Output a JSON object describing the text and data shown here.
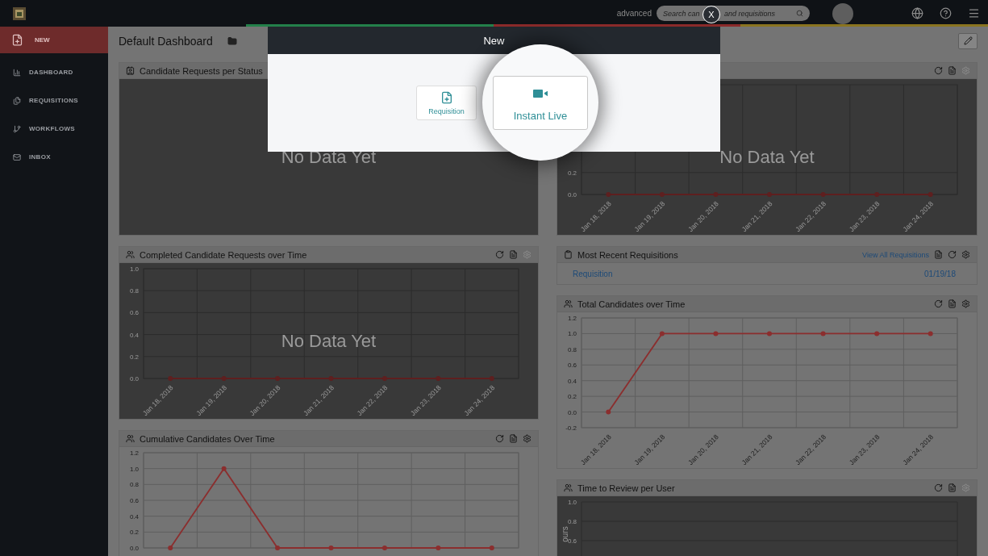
{
  "topbar": {
    "advanced_link": "advanced",
    "search": {
      "placeholder": "Search can",
      "placeholder_rest": "and requisitions"
    },
    "close_button": "X"
  },
  "sidebar": {
    "items": [
      {
        "label": "NEW",
        "kind": "action"
      },
      {
        "label": "DASHBOARD",
        "kind": "nav"
      },
      {
        "label": "REQUISITIONS",
        "kind": "nav"
      },
      {
        "label": "WORKFLOWS",
        "kind": "nav"
      },
      {
        "label": "INBOX",
        "kind": "nav"
      }
    ]
  },
  "dashboard": {
    "title": "Default Dashboard"
  },
  "columns": [
    {
      "panels": [
        {
          "kind": "empty",
          "title": "Candidate Requests per Status",
          "empty_text": "No Data Yet"
        },
        {
          "kind": "chart",
          "title": "Completed Candidate Requests over Time",
          "settings_enabled": false,
          "empty_text": "No Data Yet",
          "chart_data": {
            "type": "line",
            "grid": true,
            "categories": [
              "Jan 18, 2018",
              "Jan 19, 2018",
              "Jan 20, 2018",
              "Jan 21, 2018",
              "Jan 22, 2018",
              "Jan 23, 2018",
              "Jan 24, 2018"
            ],
            "series": [
              {
                "color": "#5e1f1f",
                "marker": "circle",
                "values": [
                  0,
                  0,
                  0,
                  0,
                  0,
                  0,
                  0
                ]
              }
            ],
            "ylim": [
              0,
              1
            ],
            "yticks": [
              {
                "value": 0,
                "label": "0.0"
              },
              {
                "value": 0.2,
                "label": "0.2"
              },
              {
                "value": 0.4,
                "label": "0.4"
              },
              {
                "value": 0.6,
                "label": "0.6"
              },
              {
                "value": 0.8,
                "label": "0.8"
              },
              {
                "value": 1,
                "label": "1.0"
              }
            ]
          }
        },
        {
          "kind": "chart",
          "title": "Cumulative Candidates Over Time",
          "settings_enabled": true,
          "chart_data": {
            "type": "line",
            "grid": true,
            "series": [
              {
                "color": "#8b2e2e",
                "marker": "circle",
                "values": [
                  0,
                  1,
                  0,
                  0,
                  0,
                  0,
                  0
                ]
              }
            ],
            "ylim": [
              0,
              1.2
            ],
            "yticks": [
              {
                "value": 0,
                "label": "0.0"
              },
              {
                "value": 0.2,
                "label": "0.2"
              },
              {
                "value": 0.4,
                "label": "0.4"
              },
              {
                "value": 0.6,
                "label": "0.6"
              },
              {
                "value": 0.8,
                "label": "0.8"
              },
              {
                "value": 1,
                "label": "1.0"
              },
              {
                "value": 1.2,
                "label": "1.2"
              }
            ]
          }
        }
      ]
    },
    {
      "panels": [
        {
          "kind": "chart",
          "settings_enabled": false,
          "empty_text": "No Data Yet",
          "chart_data": {
            "type": "line",
            "grid": true,
            "categories": [
              "Jan 18, 2018",
              "Jan 19, 2018",
              "Jan 20, 2018",
              "Jan 21, 2018",
              "Jan 22, 2018",
              "Jan 23, 2018",
              "Jan 24, 2018"
            ],
            "series": [
              {
                "color": "#5e1f1f",
                "marker": "circle",
                "values": [
                  0,
                  0,
                  0,
                  0,
                  0,
                  0,
                  0
                ]
              }
            ],
            "ylim": [
              0,
              1
            ],
            "yticks": [
              {
                "value": 0,
                "label": "0.0"
              },
              {
                "value": 0.2,
                "label": "0.2"
              }
            ]
          }
        },
        {
          "kind": "list",
          "title": "Most Recent Requisitions",
          "link": "View All Requisitions",
          "settings_enabled": true,
          "rows": [
            {
              "name": "Requisition",
              "date": "01/19/18"
            }
          ]
        },
        {
          "kind": "chart",
          "title": "Total Candidates over Time",
          "settings_enabled": true,
          "chart_data": {
            "type": "line",
            "grid": true,
            "categories": [
              "Jan 18, 2018",
              "Jan 19, 2018",
              "Jan 20, 2018",
              "Jan 21, 2018",
              "Jan 22, 2018",
              "Jan 23, 2018",
              "Jan 24, 2018"
            ],
            "series": [
              {
                "color": "#8b2e2e",
                "marker": "circle",
                "values": [
                  0,
                  1,
                  1,
                  1,
                  1,
                  1,
                  1
                ]
              }
            ],
            "ylim": [
              -0.2,
              1.2
            ],
            "yticks": [
              {
                "value": -0.2,
                "label": "-0.2"
              },
              {
                "value": 0,
                "label": "0.0"
              },
              {
                "value": 0.2,
                "label": "0.2"
              },
              {
                "value": 0.4,
                "label": "0.4"
              },
              {
                "value": 0.6,
                "label": "0.6"
              },
              {
                "value": 0.8,
                "label": "0.8"
              },
              {
                "value": 1,
                "label": "1.0"
              },
              {
                "value": 1.2,
                "label": "1.2"
              }
            ]
          }
        },
        {
          "kind": "chart",
          "title": "Time to Review per User",
          "settings_enabled": false,
          "dark": true,
          "axis": {
            "ylabel": "ours",
            "ticks": [
              "1.0",
              "0.8",
              "0.6"
            ]
          }
        }
      ]
    }
  ],
  "modal": {
    "title": "New",
    "options": [
      {
        "label": "Requisition",
        "highlighted": false
      },
      {
        "label": "Instant Live",
        "highlighted": true
      }
    ]
  }
}
